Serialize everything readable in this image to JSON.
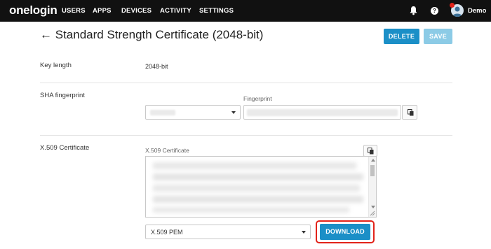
{
  "nav": {
    "logo": "onelogin",
    "items": [
      "USERS",
      "APPS",
      "DEVICES",
      "ACTIVITY",
      "SETTINGS"
    ],
    "user_name": "Demo",
    "help_glyph": "?",
    "icons": [
      "bell-icon",
      "help-icon",
      "avatar"
    ]
  },
  "page": {
    "title": "Standard Strength Certificate (2048-bit)",
    "back_arrow": "←",
    "delete_label": "DELETE",
    "save_label": "SAVE"
  },
  "key_length": {
    "label": "Key length",
    "value": "2048-bit"
  },
  "sha": {
    "label": "SHA fingerprint",
    "fingerprint_label": "Fingerprint"
  },
  "x509": {
    "label": "X.509 Certificate",
    "textarea_label": "X.509 Certificate",
    "format_value": "X.509 PEM",
    "download_label": "DOWNLOAD"
  },
  "colors": {
    "primary": "#1b8fc7",
    "primary_disabled": "#8ccbe6",
    "highlight": "#e2231a",
    "topbar": "#111111"
  }
}
